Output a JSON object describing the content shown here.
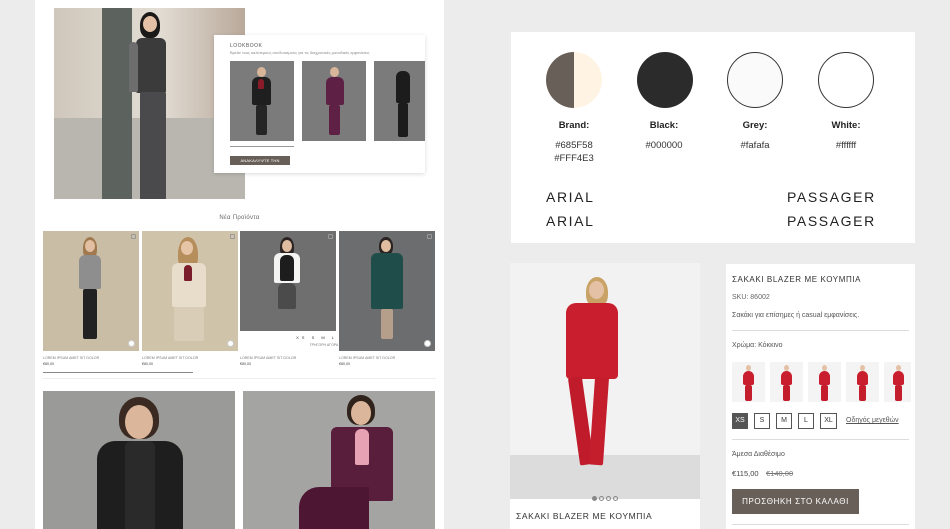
{
  "lookbook": {
    "title": "LOOKBOOK",
    "subtitle": "Βρείτε τους καλύτερους συνδυασμούς για τις διαχρονικές μοναδικές εμφανίσεις",
    "button": "ΑΝΑΚΑΛΥΨΤΕ ΤΗΝ ΣΥΛΛΟΓΗ"
  },
  "new_products": {
    "title": "Νέα Προϊόντα",
    "products": [
      {
        "name": "LOREM IPSUM AMET SIT DOLOR",
        "price": "€80,00"
      },
      {
        "name": "LOREM IPSUM AMET SIT DOLOR",
        "price": "€80,00"
      },
      {
        "name": "LOREM IPSUM AMET SIT DOLOR",
        "price": "€80,00"
      },
      {
        "name": "LOREM IPSUM AMET SIT DOLOR",
        "price": "€80,00"
      }
    ],
    "sizes": "XS S M L XL",
    "quick_add": "ΓΡΗΓΟΡΗ ΑΓΟΡΑ"
  },
  "palette": {
    "swatches": [
      {
        "label": "Brand:",
        "hex1": "#685F58",
        "hex2": "#FFF4E3",
        "color1": "#685f58",
        "color2": "#fff4e3"
      },
      {
        "label": "Black:",
        "hex1": "#000000",
        "hex2": "",
        "color1": "#2b2b2b",
        "color2": "#2b2b2b"
      },
      {
        "label": "Grey:",
        "hex1": "#fafafa",
        "hex2": "",
        "color1": "#fafafa",
        "color2": "#fafafa"
      },
      {
        "label": "White:",
        "hex1": "#ffffff",
        "hex2": "",
        "color1": "#ffffff",
        "color2": "#ffffff"
      }
    ],
    "fonts": {
      "left1": "ARIAL",
      "left2": "ARIAL",
      "right1": "PASSAGER",
      "right2": "PASSAGER"
    }
  },
  "mobile": {
    "title": "ΣΑΚΑΚΙ BLAZER ΜΕ ΚΟΥΜΠΙΑ",
    "dots": 4,
    "active_dot": 1
  },
  "detail": {
    "title": "ΣΑΚΑΚΙ BLAZER ΜΕ ΚΟΥΜΠΙΑ",
    "sku": "SKU: 86002",
    "description": "Σακάκι για επίσημες ή casual εμφανίσεις.",
    "color_label": "Χρώμα: Κόκκινο",
    "sizes": [
      "XS",
      "S",
      "M",
      "L",
      "XL"
    ],
    "selected_size": "XS",
    "size_guide": "Οδηγός μεγεθών",
    "availability": "Άμεσα Διαθέσιμο",
    "price": "€115,00",
    "old_price": "€140,00",
    "add_to_cart": "ΠΡΟΣΘΗΚΗ ΣΤΟ ΚΑΛΑΘΙ"
  }
}
